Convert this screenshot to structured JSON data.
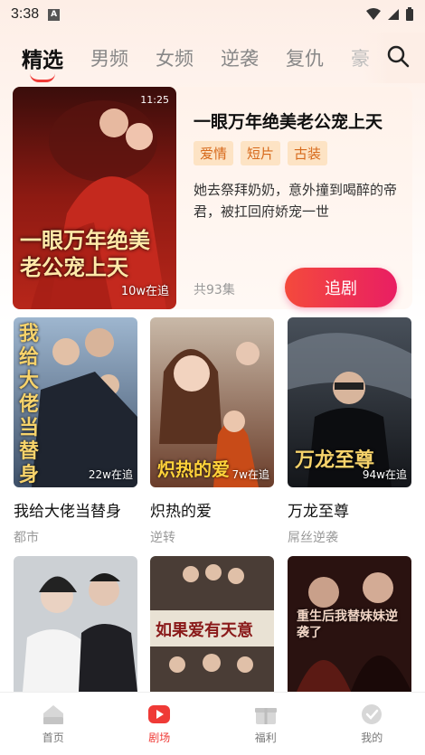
{
  "status": {
    "time": "3:38",
    "notif": "A"
  },
  "tabs": [
    {
      "label": "精选",
      "active": true
    },
    {
      "label": "男频"
    },
    {
      "label": "女频"
    },
    {
      "label": "逆袭"
    },
    {
      "label": "复仇"
    },
    {
      "label": "豪"
    }
  ],
  "featured": {
    "title": "一眼万年绝美老公宠上天",
    "genres": [
      "爱情",
      "短片",
      "古装"
    ],
    "description": "她去祭拜奶奶，意外撞到喝醉的帝君，被扛回府娇宠一世",
    "episodes": "共93集",
    "follow_label": "追剧",
    "cover_views": "10w在追",
    "cover_time": "11:25",
    "cover_text": "一眼万年绝美老公宠上天"
  },
  "grid": [
    {
      "title": "我给大佬当替身",
      "genre": "都市",
      "views": "22w在追",
      "cover_text": "我给大佬当替身"
    },
    {
      "title": "炽热的爱",
      "genre": "逆转",
      "views": "7w在追",
      "cover_text": "炽热的爱"
    },
    {
      "title": "万龙至尊",
      "genre": "屌丝逆袭",
      "views": "94w在追",
      "cover_text": "万龙至尊"
    },
    {
      "cover_text": ""
    },
    {
      "cover_text": "如果爱有天意"
    },
    {
      "cover_text": "重生后我替妹妹逆袭了"
    }
  ],
  "nav": [
    {
      "label": "首页",
      "icon": "home-icon"
    },
    {
      "label": "剧场",
      "icon": "theater-play-icon",
      "active": true
    },
    {
      "label": "福利",
      "icon": "gift-icon"
    },
    {
      "label": "我的",
      "icon": "profile-icon"
    }
  ],
  "colors": {
    "accent": "#ef3a36",
    "genre_bg": "#fde3c4",
    "genre_text": "#d76a1c"
  }
}
